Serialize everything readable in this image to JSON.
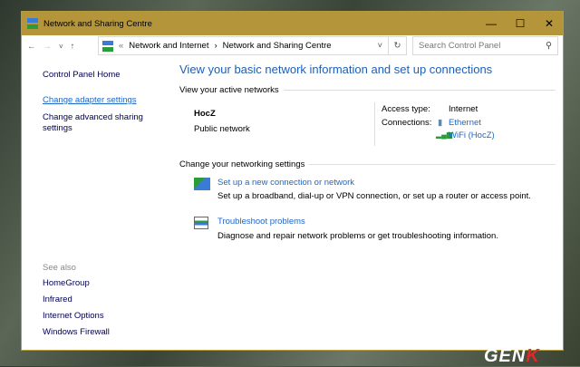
{
  "window": {
    "title": "Network and Sharing Centre",
    "minimize": "—",
    "maximize": "☐",
    "close": "✕"
  },
  "nav": {
    "back": "←",
    "forward": "→",
    "recent": "˅",
    "up": "↑",
    "refresh": "↻",
    "dropdown": "˅"
  },
  "address": {
    "prefix": "«",
    "crumbs": [
      "Network and Internet",
      "Network and Sharing Centre"
    ],
    "sep": "›"
  },
  "search": {
    "placeholder": "Search Control Panel",
    "icon": "⚲"
  },
  "sidebar": {
    "home": "Control Panel Home",
    "items": [
      "Change adapter settings",
      "Change advanced sharing settings"
    ],
    "see_also": "See also",
    "see_also_items": [
      "HomeGroup",
      "Infrared",
      "Internet Options",
      "Windows Firewall"
    ]
  },
  "main": {
    "title": "View your basic network information and set up connections",
    "active_label": "View your active networks",
    "network": {
      "name": "HocZ",
      "type": "Public network",
      "access_label": "Access type:",
      "access_value": "Internet",
      "connections_label": "Connections:",
      "connections": [
        "Ethernet",
        "WiFi (HocZ)"
      ]
    },
    "change_label": "Change your networking settings",
    "tasks": [
      {
        "title": "Set up a new connection or network",
        "desc": "Set up a broadband, dial-up or VPN connection, or set up a router or access point."
      },
      {
        "title": "Troubleshoot problems",
        "desc": "Diagnose and repair network problems or get troubleshooting information."
      }
    ]
  },
  "watermark": {
    "text": "GEN",
    "accent": "K"
  }
}
